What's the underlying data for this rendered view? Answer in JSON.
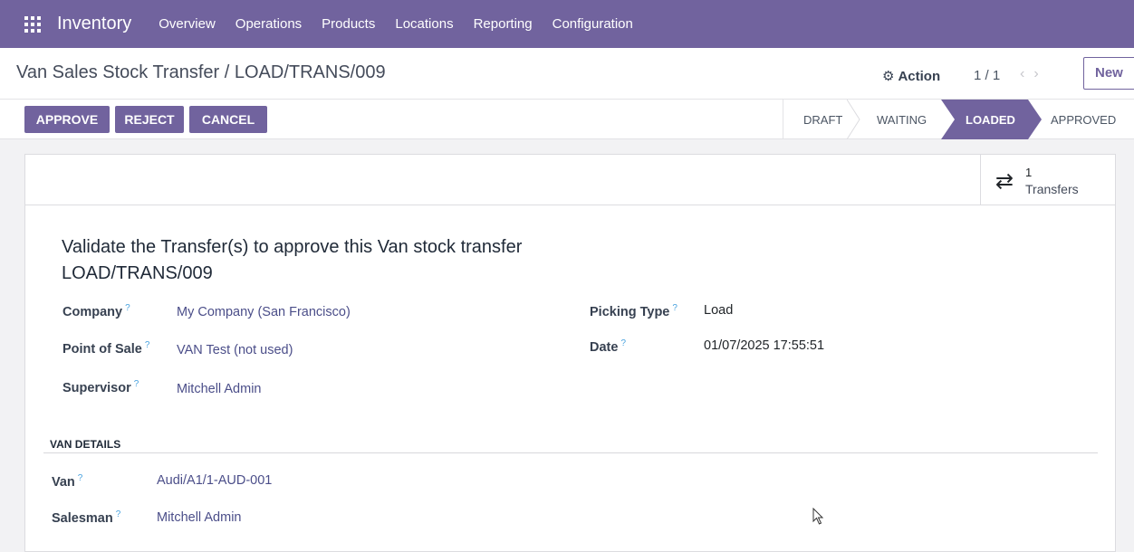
{
  "navbar": {
    "app_name": "Inventory",
    "menu": [
      "Overview",
      "Operations",
      "Products",
      "Locations",
      "Reporting",
      "Configuration"
    ]
  },
  "control": {
    "breadcrumb": "Van Sales Stock Transfer / LOAD/TRANS/009",
    "action_label": "Action",
    "pager": "1 / 1",
    "new_label": "New"
  },
  "buttons": {
    "approve": "APPROVE",
    "reject": "REJECT",
    "cancel": "CANCEL"
  },
  "statusbar": {
    "stages": [
      "DRAFT",
      "WAITING",
      "LOADED",
      "APPROVED"
    ],
    "active": "LOADED"
  },
  "smart_button": {
    "count": "1",
    "label": "Transfers"
  },
  "form": {
    "title_line1": "Validate the Transfer(s) to approve this Van stock transfer",
    "title_line2": "LOAD/TRANS/009",
    "company_label": "Company",
    "company_value": "My Company (San Francisco)",
    "pos_label": "Point of Sale",
    "pos_value": "VAN Test (not used)",
    "supervisor_label": "Supervisor",
    "supervisor_value": "Mitchell Admin",
    "picking_label": "Picking Type",
    "picking_value": "Load",
    "date_label": "Date",
    "date_value": "01/07/2025 17:55:51",
    "section_title": "VAN DETAILS",
    "van_label": "Van",
    "van_value": "Audi/A1/1-AUD-001",
    "salesman_label": "Salesman",
    "salesman_value": "Mitchell Admin",
    "help_mark": "?"
  },
  "colors": {
    "brand": "#71639e",
    "link": "#4b4e89",
    "help": "#4aa3df"
  }
}
